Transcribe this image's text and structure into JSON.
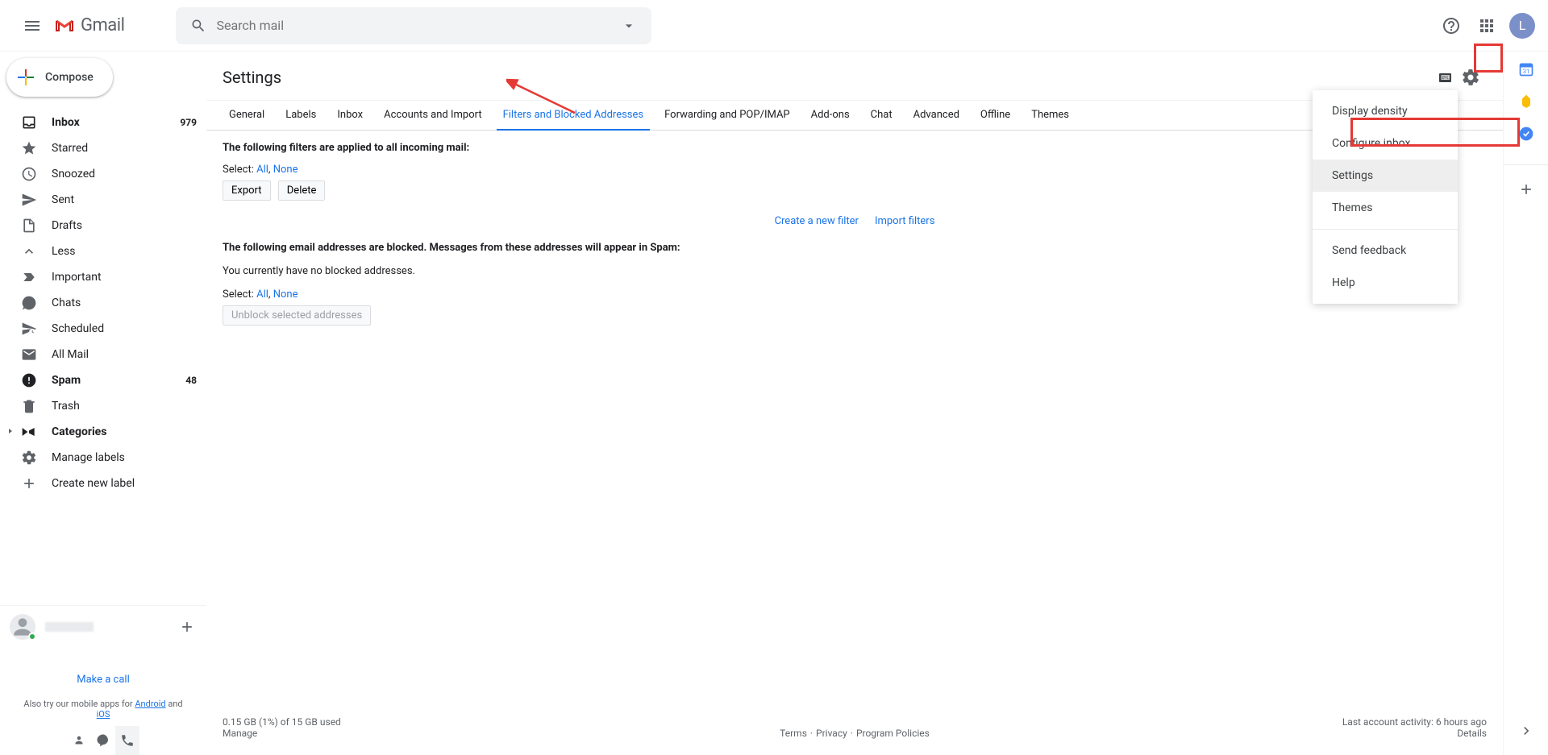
{
  "header": {
    "logo_text": "Gmail",
    "search_placeholder": "Search mail",
    "avatar_initial": "L"
  },
  "compose": {
    "label": "Compose"
  },
  "nav": [
    {
      "label": "Inbox",
      "count": "979",
      "icon": "inbox",
      "bold": true
    },
    {
      "label": "Starred",
      "count": "",
      "icon": "star",
      "bold": false
    },
    {
      "label": "Snoozed",
      "count": "",
      "icon": "clock",
      "bold": false
    },
    {
      "label": "Sent",
      "count": "",
      "icon": "send",
      "bold": false
    },
    {
      "label": "Drafts",
      "count": "",
      "icon": "file",
      "bold": false
    },
    {
      "label": "Less",
      "count": "",
      "icon": "up",
      "bold": false
    },
    {
      "label": "Important",
      "count": "",
      "icon": "important",
      "bold": false
    },
    {
      "label": "Chats",
      "count": "",
      "icon": "chats",
      "bold": false
    },
    {
      "label": "Scheduled",
      "count": "",
      "icon": "scheduled",
      "bold": false
    },
    {
      "label": "All Mail",
      "count": "",
      "icon": "allmail",
      "bold": false
    },
    {
      "label": "Spam",
      "count": "48",
      "icon": "spam",
      "bold": true
    },
    {
      "label": "Trash",
      "count": "",
      "icon": "trash",
      "bold": false
    },
    {
      "label": "Categories",
      "count": "",
      "icon": "categories",
      "bold": true,
      "arrow": true
    },
    {
      "label": "Manage labels",
      "count": "",
      "icon": "gear2",
      "bold": false
    },
    {
      "label": "Create new label",
      "count": "",
      "icon": "plus",
      "bold": false
    }
  ],
  "hangouts": {
    "make_call": "Make a call",
    "mobile_text_pre": "Also try our mobile apps for ",
    "mobile_android": "Android",
    "mobile_mid": " and ",
    "mobile_ios": "iOS"
  },
  "settings": {
    "title": "Settings",
    "tabs": [
      "General",
      "Labels",
      "Inbox",
      "Accounts and Import",
      "Filters and Blocked Addresses",
      "Forwarding and POP/IMAP",
      "Add-ons",
      "Chat",
      "Advanced",
      "Offline",
      "Themes"
    ],
    "active_tab_index": 4,
    "filters_applied_text": "The following filters are applied to all incoming mail:",
    "select_label": "Select:",
    "select_all": "All",
    "select_none": "None",
    "export_btn": "Export",
    "delete_btn": "Delete",
    "create_filter": "Create a new filter",
    "import_filters": "Import filters",
    "blocked_text": "The following email addresses are blocked. Messages from these addresses will appear in Spam:",
    "no_blocked": "You currently have no blocked addresses.",
    "unblock_btn": "Unblock selected addresses"
  },
  "quick_menu": {
    "items": [
      "Display density",
      "Configure inbox",
      "Settings",
      "Themes"
    ],
    "divider_after": 3,
    "items2": [
      "Send feedback",
      "Help"
    ],
    "highlighted_index": 2
  },
  "footer": {
    "storage": "0.15 GB (1%) of 15 GB used",
    "manage": "Manage",
    "terms": "Terms",
    "privacy": "Privacy",
    "policies": "Program Policies",
    "activity": "Last account activity: 6 hours ago",
    "details": "Details"
  }
}
